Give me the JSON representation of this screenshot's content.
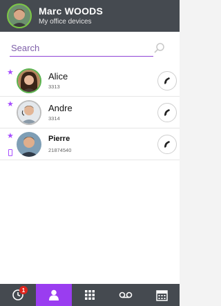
{
  "header": {
    "name": "Marc WOODS",
    "subtitle": "My office devices"
  },
  "search": {
    "placeholder": "Search"
  },
  "contacts": [
    {
      "name": "Alice",
      "number": "3313",
      "favorite": true,
      "presence": "green"
    },
    {
      "name": "Andre",
      "number": "3314",
      "favorite": true,
      "presence": "grey"
    },
    {
      "name": "Pierre",
      "number": "21874540",
      "favorite": true,
      "presence": "none",
      "mobile": true
    }
  ],
  "tabbar": {
    "tabs": [
      {
        "id": "history",
        "icon": "clock-icon",
        "badge": "1"
      },
      {
        "id": "contacts",
        "icon": "person-icon",
        "active": true
      },
      {
        "id": "dialpad",
        "icon": "dialpad-icon"
      },
      {
        "id": "voicemail",
        "icon": "voicemail-icon"
      },
      {
        "id": "calendar",
        "icon": "calendar-icon"
      }
    ]
  },
  "colors": {
    "header_bg": "#454a50",
    "accent": "#9a3df0",
    "favorite": "#a64dff",
    "badge": "#e0231b",
    "presence_available": "#59b34d"
  }
}
